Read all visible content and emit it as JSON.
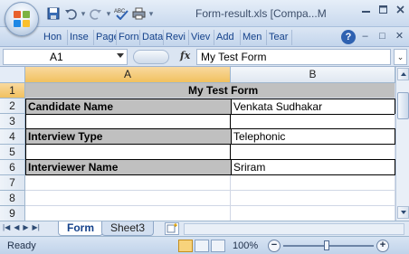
{
  "window": {
    "title": "Form-result.xls  [Compa...M",
    "minimize_icon": "minimize-icon",
    "restore_icon": "restore-icon",
    "close_icon": "close-icon"
  },
  "quick_access": {
    "icons": [
      "save-icon",
      "undo-icon",
      "redo-icon",
      "spelling-icon",
      "print-icon",
      "customize-icon"
    ]
  },
  "ribbon": {
    "tabs": [
      "Hon",
      "Inse",
      "Page",
      "Forn",
      "Data",
      "Revi",
      "Viev",
      "Add",
      "Men",
      "Tear"
    ]
  },
  "formula_bar": {
    "name_box": "A1",
    "fx_label": "fx",
    "content": "My Test Form"
  },
  "grid": {
    "columns": [
      "A",
      "B"
    ],
    "rows": [
      "1",
      "2",
      "3",
      "4",
      "5",
      "6",
      "7",
      "8",
      "9"
    ],
    "cells": {
      "title": "My Test Form",
      "r2a": "Candidate Name",
      "r2b": "Venkata Sudhakar",
      "r4a": "Interview Type",
      "r4b": "Telephonic",
      "r6a": "Interviewer Name",
      "r6b": "Sriram"
    }
  },
  "sheets": [
    "Form",
    "Sheet3"
  ],
  "status": {
    "ready": "Ready",
    "zoom": "100%"
  },
  "colors": {
    "ribbon_text": "#15428b",
    "header_active": "#f1c15f",
    "label_fill": "#c0c0c0"
  }
}
